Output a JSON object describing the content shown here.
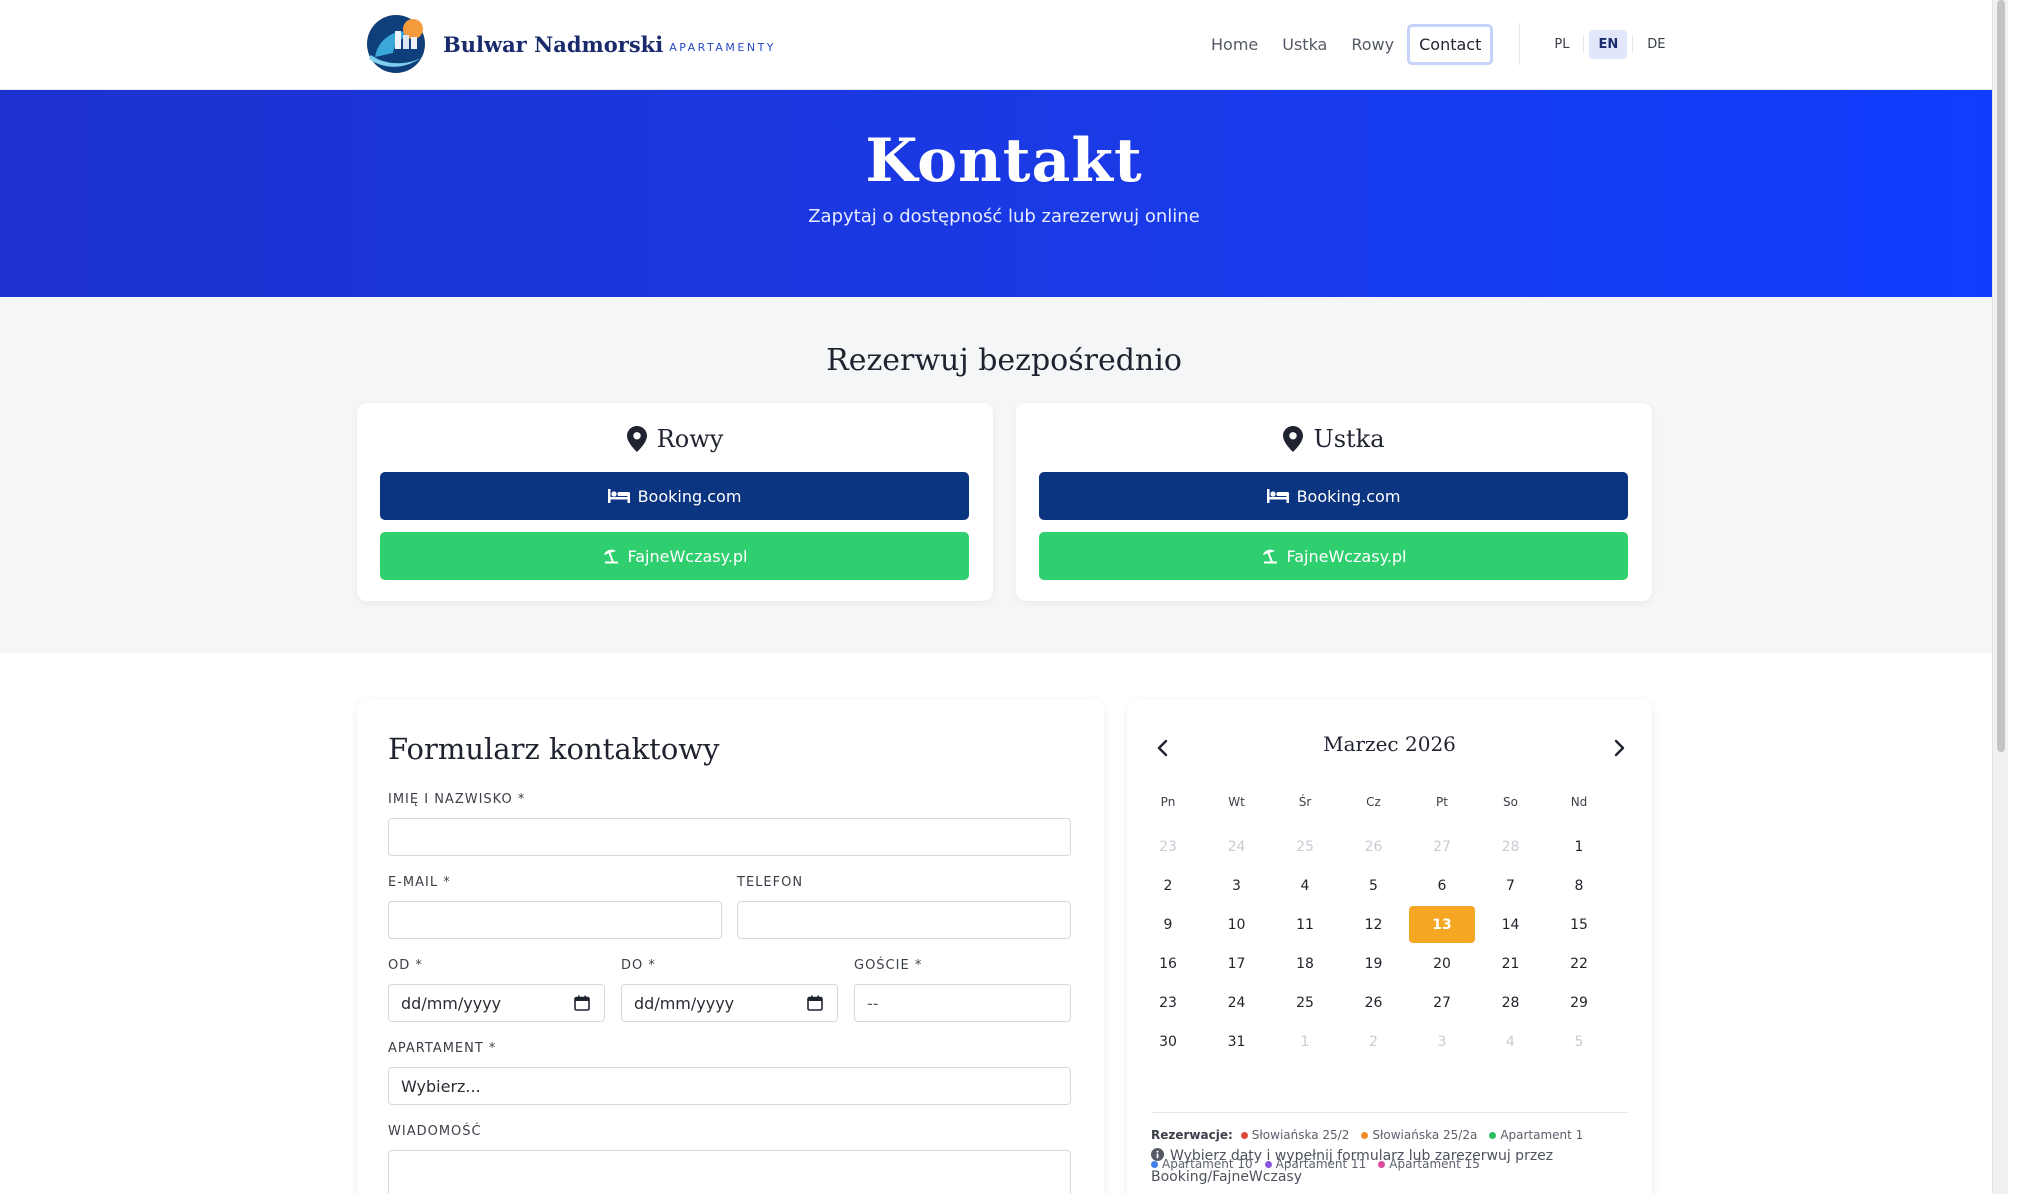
{
  "brand": {
    "name": "Bulwar Nadmorski",
    "sub": "APARTAMENTY"
  },
  "nav": {
    "items": [
      {
        "label": "Home"
      },
      {
        "label": "Ustka"
      },
      {
        "label": "Rowy"
      },
      {
        "label": "Contact",
        "active": true
      }
    ],
    "langs": [
      "PL",
      "EN",
      "DE"
    ],
    "active_lang": "EN"
  },
  "hero": {
    "title": "Kontakt",
    "subtitle": "Zapytaj o dostępność lub zarezerwuj online"
  },
  "book": {
    "title": "Rezerwuj bezpośrednio",
    "locations": [
      {
        "name": "Rowy",
        "booking": "Booking.com",
        "fajne": "FajneWczasy.pl"
      },
      {
        "name": "Ustka",
        "booking": "Booking.com",
        "fajne": "FajneWczasy.pl"
      }
    ]
  },
  "form": {
    "title": "Formularz kontaktowy",
    "name_label": "IMIĘ I NAZWISKO *",
    "email_label": "E-MAIL *",
    "phone_label": "TELEFON",
    "from_label": "OD *",
    "to_label": "DO *",
    "guests_label": "GOŚCIE *",
    "date_placeholder": "dd/mm/yyyy",
    "guests_value": "--",
    "apartment_label": "APARTAMENT *",
    "apartment_value": "Wybierz...",
    "message_label": "WIADOMOŚĆ"
  },
  "calendar": {
    "month": "Marzec 2026",
    "weekdays": [
      "Pn",
      "Wt",
      "Śr",
      "Cz",
      "Pt",
      "So",
      "Nd"
    ],
    "weeks": [
      [
        "23",
        "24",
        "25",
        "26",
        "27",
        "28",
        "1"
      ],
      [
        "2",
        "3",
        "4",
        "5",
        "6",
        "7",
        "8"
      ],
      [
        "9",
        "10",
        "11",
        "12",
        "13",
        "14",
        "15"
      ],
      [
        "16",
        "17",
        "18",
        "19",
        "20",
        "21",
        "22"
      ],
      [
        "23",
        "24",
        "25",
        "26",
        "27",
        "28",
        "29"
      ],
      [
        "30",
        "31",
        "1",
        "2",
        "3",
        "4",
        "5"
      ]
    ],
    "today": "13",
    "legend_label": "Rezerwacje:",
    "legend": [
      {
        "name": "Słowiańska 25/2",
        "color": "#e0483e"
      },
      {
        "name": "Słowiańska 25/2a",
        "color": "#f08a24"
      },
      {
        "name": "Apartament 1",
        "color": "#2ebd62"
      },
      {
        "name": "Apartament 10",
        "color": "#3f7ee8"
      },
      {
        "name": "Apartament 11",
        "color": "#8a55e0"
      },
      {
        "name": "Apartament 15",
        "color": "#e04a9a"
      }
    ],
    "note": "Wybierz daty i wypełnij formularz lub zarezerwuj przez Booking/FajneWczasy"
  },
  "colors": {
    "primary": "#0b3580",
    "green": "#2fce6e",
    "accent": "#f5a623",
    "hero": "#1a3ae6"
  }
}
